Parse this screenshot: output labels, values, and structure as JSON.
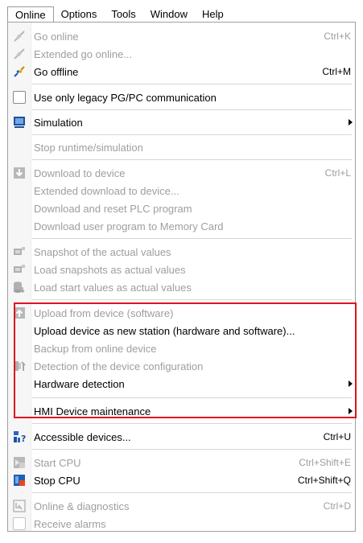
{
  "menubar": {
    "items": [
      "Online",
      "Options",
      "Tools",
      "Window",
      "Help"
    ]
  },
  "menu": {
    "go_online": {
      "label": "Go online",
      "shortcut": "Ctrl+K"
    },
    "extended_go_online": {
      "label": "Extended go online..."
    },
    "go_offline": {
      "label": "Go offline",
      "shortcut": "Ctrl+M"
    },
    "legacy_pgpc": {
      "label": "Use only legacy PG/PC communication"
    },
    "simulation": {
      "label": "Simulation"
    },
    "stop_runtime": {
      "label": "Stop runtime/simulation"
    },
    "download_device": {
      "label": "Download to device",
      "shortcut": "Ctrl+L"
    },
    "extended_download": {
      "label": "Extended download to device..."
    },
    "download_reset": {
      "label": "Download and reset PLC program"
    },
    "download_memory_card": {
      "label": "Download user program to Memory Card"
    },
    "snapshot": {
      "label": "Snapshot of the actual values"
    },
    "load_snapshots": {
      "label": "Load snapshots as actual values"
    },
    "load_start_values": {
      "label": "Load start values as actual values"
    },
    "upload_software": {
      "label": "Upload from device (software)"
    },
    "upload_new_station": {
      "label": "Upload device as new station (hardware and software)..."
    },
    "backup_online": {
      "label": "Backup from online device"
    },
    "detection_config": {
      "label": "Detection of the device configuration"
    },
    "hardware_detection": {
      "label": "Hardware detection"
    },
    "hmi_maintenance": {
      "label": "HMI Device maintenance"
    },
    "accessible_devices": {
      "label": "Accessible devices...",
      "shortcut": "Ctrl+U"
    },
    "start_cpu": {
      "label": "Start CPU",
      "shortcut": "Ctrl+Shift+E"
    },
    "stop_cpu": {
      "label": "Stop CPU",
      "shortcut": "Ctrl+Shift+Q"
    },
    "online_diagnostics": {
      "label": "Online & diagnostics",
      "shortcut": "Ctrl+D"
    },
    "receive_alarms": {
      "label": "Receive alarms"
    }
  },
  "colors": {
    "highlight_border": "#e0131f",
    "disabled_text": "#9e9e9e"
  }
}
